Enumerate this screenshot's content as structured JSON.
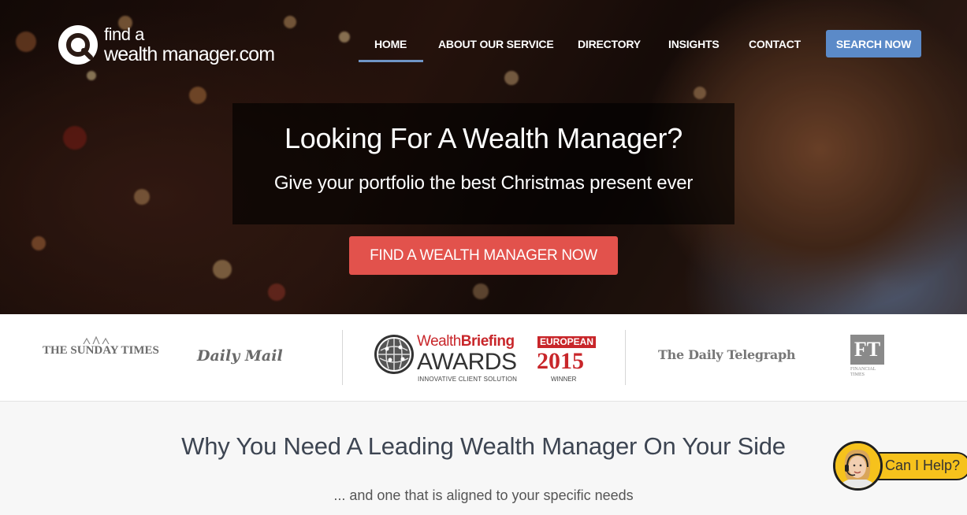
{
  "brand": {
    "logo_line1": "find a",
    "logo_line2": "wealth manager.com",
    "accent": "#5b8ac8",
    "cta_color": "#e2524c"
  },
  "nav": {
    "items": [
      {
        "label": "HOME",
        "active": true
      },
      {
        "label": "ABOUT OUR SERVICE",
        "active": false
      },
      {
        "label": "DIRECTORY",
        "active": false
      },
      {
        "label": "INSIGHTS",
        "active": false
      },
      {
        "label": "CONTACT",
        "active": false
      }
    ],
    "search_button": "SEARCH NOW"
  },
  "hero": {
    "title": "Looking For A Wealth Manager?",
    "subtitle": "Give your portfolio the best Christmas present ever",
    "cta": "FIND A WEALTH MANAGER NOW"
  },
  "press": {
    "sunday_times": "THE SUNDAY TIMES",
    "daily_mail": "Daily Mail",
    "awards": {
      "wealth": "Wealth",
      "briefing": "Briefing",
      "european": "EUROPEAN",
      "awards": "AWARDS",
      "year": "2015",
      "category": "INNOVATIVE CLIENT SOLUTION",
      "winner": "WINNER"
    },
    "telegraph": "The Daily Telegraph",
    "ft": {
      "mark": "FT",
      "line1": "FINANCIAL",
      "line2": "TIMES"
    }
  },
  "why": {
    "title": "Why You Need A Leading Wealth Manager On Your Side",
    "subtitle": "... and one that is aligned to your specific needs"
  },
  "chat": {
    "label": "Can I Help?",
    "icon": "support-agent-icon"
  }
}
